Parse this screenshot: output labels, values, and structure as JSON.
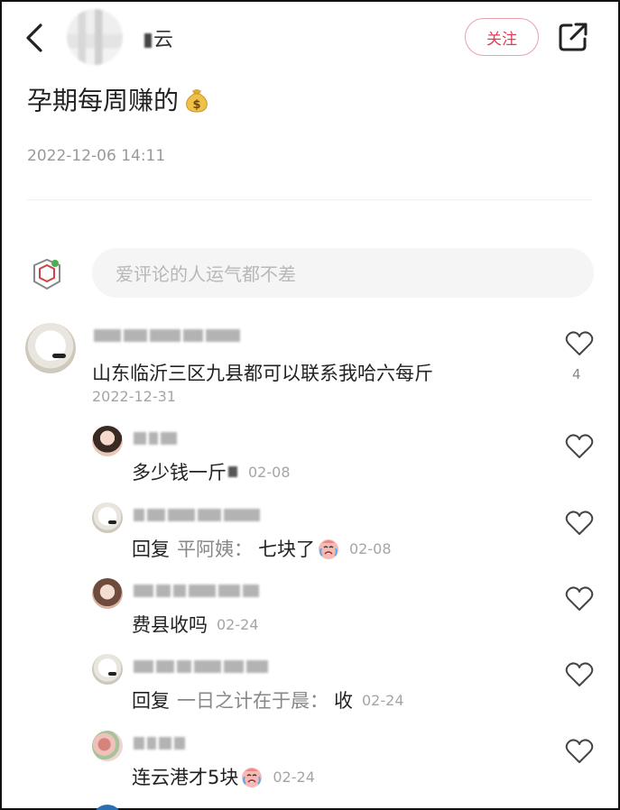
{
  "header": {
    "author_name": "云",
    "follow_label": "关注"
  },
  "post": {
    "title": "孕期每周赚的",
    "time": "2022-12-06 14:11"
  },
  "comment_input": {
    "placeholder": "爱评论的人运气都不差"
  },
  "comments": [
    {
      "text": "山东临沂三区九县都可以联系我哈六每斤",
      "date": "2022-12-31",
      "like_count": "4"
    }
  ],
  "replies": [
    {
      "text": "多少钱一斤",
      "date": "02-08"
    },
    {
      "reply_word": "回复",
      "reply_to": "平阿姨：",
      "text": "七块了",
      "date": "02-08"
    },
    {
      "text": "费县收吗",
      "date": "02-24"
    },
    {
      "reply_word": "回复",
      "reply_to": "一日之计在于晨：",
      "text": "收",
      "date": "02-24"
    },
    {
      "text": "连云港才5块",
      "date": "02-24"
    }
  ],
  "colors": {
    "accent": "#e33d55",
    "muted": "#a5a5a5"
  },
  "icons": {
    "back": "chevron-left-icon",
    "share": "share-external-icon",
    "like": "heart-outline-icon",
    "money": "money-bag-icon",
    "cry": "crying-face-icon"
  }
}
